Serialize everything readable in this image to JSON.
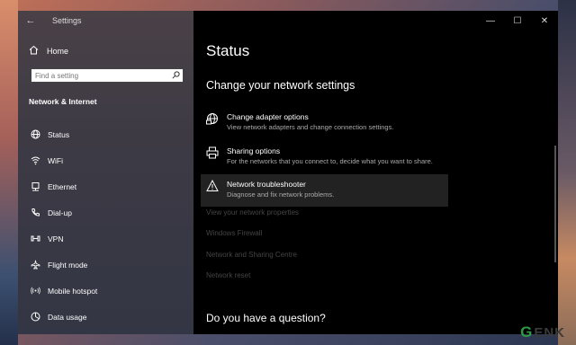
{
  "window": {
    "title": "Settings"
  },
  "sidebar": {
    "home_label": "Home",
    "search_placeholder": "Find a setting",
    "section_title": "Network & Internet",
    "items": [
      {
        "label": "Status",
        "icon": "globe-icon"
      },
      {
        "label": "WiFi",
        "icon": "wifi-icon"
      },
      {
        "label": "Ethernet",
        "icon": "ethernet-icon"
      },
      {
        "label": "Dial-up",
        "icon": "phone-icon"
      },
      {
        "label": "VPN",
        "icon": "vpn-icon"
      },
      {
        "label": "Flight mode",
        "icon": "airplane-icon"
      },
      {
        "label": "Mobile hotspot",
        "icon": "hotspot-icon"
      },
      {
        "label": "Data usage",
        "icon": "data-usage-icon"
      }
    ]
  },
  "main": {
    "title": "Status",
    "subheading": "Change your network settings",
    "options": [
      {
        "title": "Change adapter options",
        "desc": "View network adapters and change connection settings.",
        "icon": "adapter-icon"
      },
      {
        "title": "Sharing options",
        "desc": "For the networks that you connect to, decide what you want to share.",
        "icon": "printer-icon"
      },
      {
        "title": "Network troubleshooter",
        "desc": "Diagnose and fix network problems.",
        "icon": "warning-icon"
      }
    ],
    "links": [
      "View your network properties",
      "Windows Firewall",
      "Network and Sharing Centre",
      "Network reset"
    ],
    "question": "Do you have a question?"
  },
  "watermark": {
    "first": "G",
    "rest": "ENK"
  }
}
